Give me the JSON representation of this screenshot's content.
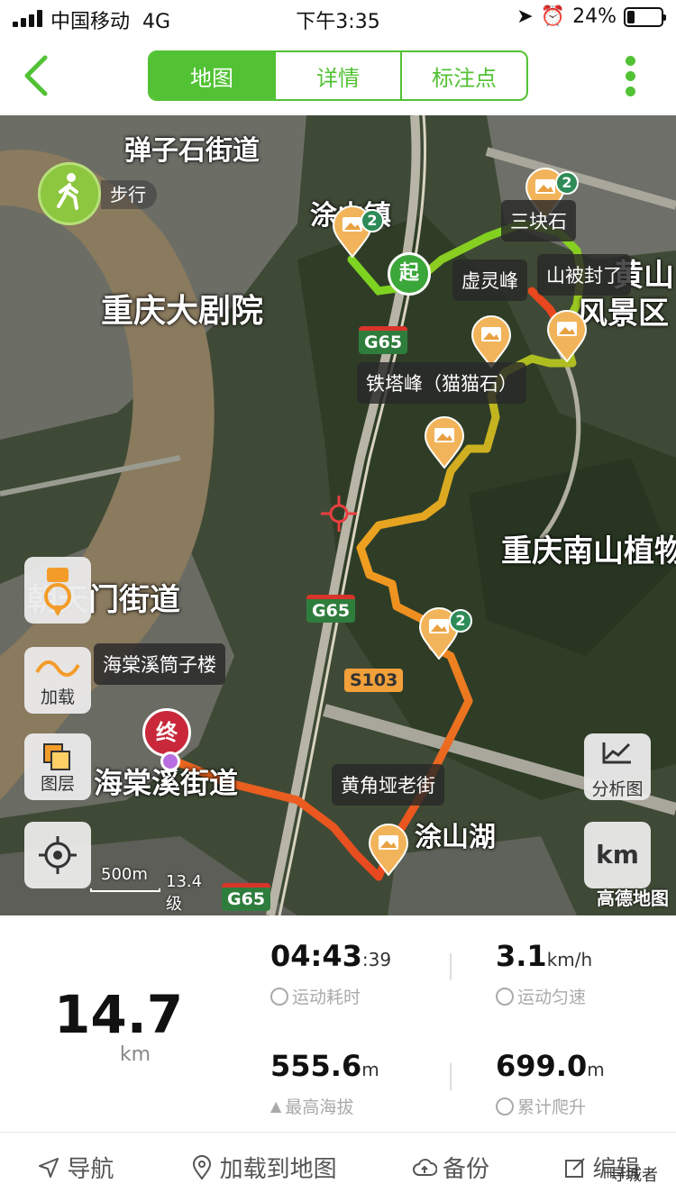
{
  "status_bar": {
    "carrier": "中国移动",
    "network": "4G",
    "time": "下午3:35",
    "battery": "24%"
  },
  "nav": {
    "tabs": [
      "地图",
      "详情",
      "标注点"
    ],
    "active_tab": "地图"
  },
  "map": {
    "mode_label": "步行",
    "places": {
      "danzishi": "弹子石街道",
      "tushan_town": "涂山镇",
      "grand_theatre": "重庆大剧院",
      "nanshan_botanical": "重庆南山植物",
      "huangshan": "黄山",
      "scenic": "风景区",
      "chaotianmen": "朝天门街道",
      "haitangxi_street": "海棠溪街道",
      "tushan_lake": "涂山湖"
    },
    "road_shields": [
      "G65",
      "G65",
      "S103",
      "G65"
    ],
    "callouts": {
      "sankuaishi": "三块石",
      "xulingfeng": "虚灵峰",
      "shan_closed": "山被封了",
      "tietafeng": "铁塔峰（猫猫石）",
      "haitangxi_building": "海棠溪筒子楼",
      "huangjiaoya": "黄角垭老街"
    },
    "start_marker": "起",
    "end_marker": "终",
    "cluster_count": "2",
    "side_buttons": {
      "load": "加载",
      "layers": "图层"
    },
    "analysis_button": "分析图",
    "unit_button": "km",
    "scale_label": "500m",
    "zoom_label": "13.4级",
    "attribution": "高德地图"
  },
  "stats": {
    "distance": "14.7",
    "distance_unit": "km",
    "duration_main": "04:43",
    "duration_sec": ":39",
    "duration_label": "运动耗时",
    "pace_value": "3.1",
    "pace_unit": "km/h",
    "pace_label": "运动匀速",
    "max_alt_value": "555.6",
    "max_alt_unit": "m",
    "max_alt_label": "最高海拔",
    "climb_value": "699.0",
    "climb_unit": "m",
    "climb_label": "累计爬升"
  },
  "toolbar": {
    "navigate": "导航",
    "load_to_map": "加载到地图",
    "backup": "备份",
    "edit": "编辑"
  },
  "watermark": "寻城者",
  "colors": {
    "accent": "#52c234",
    "track_start": "#7ed321",
    "track_end": "#e8471f"
  }
}
